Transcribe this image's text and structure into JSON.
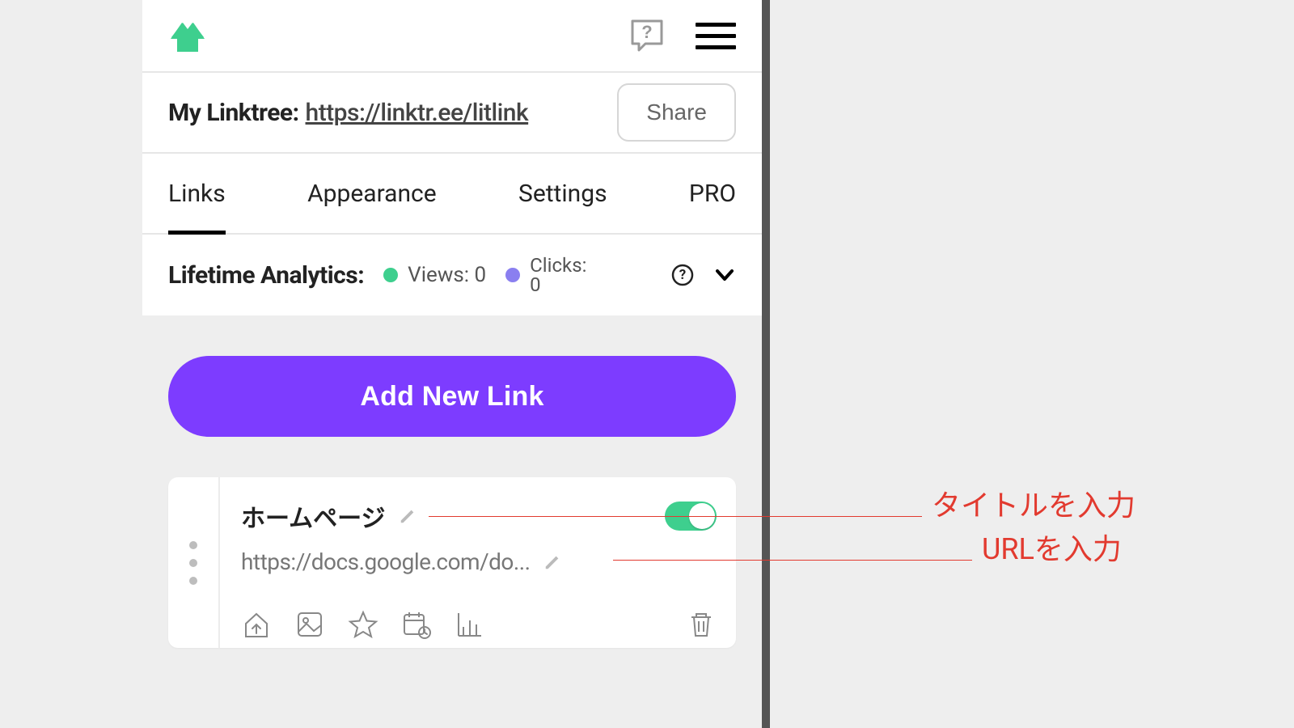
{
  "header": {
    "my_linktree_label": "My Linktree:",
    "my_linktree_url": "https://linktr.ee/litlink",
    "share_label": "Share"
  },
  "tabs": {
    "links": "Links",
    "appearance": "Appearance",
    "settings": "Settings",
    "pro": "PRO"
  },
  "analytics": {
    "title": "Lifetime Analytics:",
    "views_label": "Views:",
    "views_value": "0",
    "clicks_label": "Clicks:",
    "clicks_value": "0"
  },
  "actions": {
    "add_new_link": "Add New Link"
  },
  "link_card": {
    "title": "ホームページ",
    "url": "https://docs.google.com/do...",
    "enabled": true
  },
  "annotations": {
    "title_input": "タイトルを入力",
    "url_input": "URLを入力"
  },
  "colors": {
    "accent_purple": "#7d3cff",
    "toggle_green": "#3ecf8e",
    "annotation_red": "#e23a2f"
  }
}
